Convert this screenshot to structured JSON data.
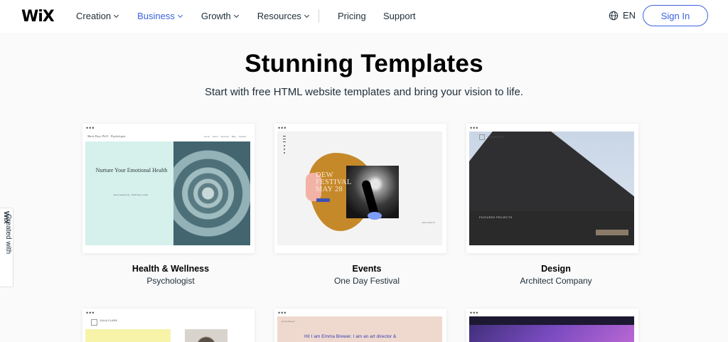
{
  "header": {
    "logo": "WiX",
    "nav": [
      {
        "label": "Creation",
        "active": false
      },
      {
        "label": "Business",
        "active": true
      },
      {
        "label": "Growth",
        "active": false
      },
      {
        "label": "Resources",
        "active": false
      }
    ],
    "pricing": "Pricing",
    "support": "Support",
    "language": "EN",
    "signin": "Sign In",
    "accent_color": "#3b63e0"
  },
  "hero": {
    "title": "Stunning Templates",
    "subtitle": "Start with free HTML website templates and bring your vision to life."
  },
  "side_tag": {
    "prefix": "Created with",
    "brand": "Wix"
  },
  "templates": [
    {
      "title": "Health & Wellness",
      "subtitle": "Psychologist",
      "preview": {
        "brand": "Marie Pays, Ph.D. · Psychologist",
        "menu": "Home About Services Blog Contact",
        "heading": "Nurture Your Emotional Health",
        "small": "Get a session by · Click here to start"
      }
    },
    {
      "title": "Events",
      "subtitle": "One Day Festival",
      "preview": {
        "title": "DEW FESTIVAL MAY 28",
        "corner": "SEE EVENTS"
      }
    },
    {
      "title": "Design",
      "subtitle": "Architect Company",
      "preview": {
        "brand": "ARCHITECTS",
        "label": "FEATURED PROJECTS"
      }
    },
    {
      "title": "",
      "subtitle": "",
      "preview": {
        "name": "JULIA CLARK"
      }
    },
    {
      "title": "",
      "subtitle": "",
      "preview": {
        "head": "Emma Brewer",
        "text": "Hi! I am Emma Brewer. I am an art director &"
      }
    },
    {
      "title": "",
      "subtitle": "",
      "preview": {}
    }
  ]
}
